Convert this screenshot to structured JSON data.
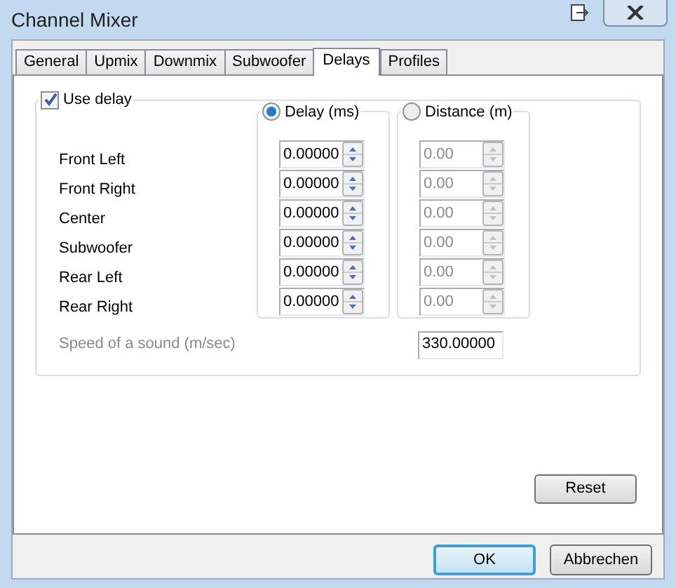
{
  "window": {
    "title": "Channel Mixer"
  },
  "tabs": [
    {
      "label": "General",
      "selected": false
    },
    {
      "label": "Upmix",
      "selected": false
    },
    {
      "label": "Downmix",
      "selected": false
    },
    {
      "label": "Subwoofer",
      "selected": false
    },
    {
      "label": "Delays",
      "selected": true
    },
    {
      "label": "Profiles",
      "selected": false
    }
  ],
  "use_delay": {
    "label": "Use delay",
    "checked": true
  },
  "mode_options": [
    {
      "label": "Delay (ms)",
      "selected": true
    },
    {
      "label": "Distance (m)",
      "selected": false
    }
  ],
  "channels": [
    {
      "name": "Front Left",
      "delay": "0.00000",
      "distance": "0.00"
    },
    {
      "name": "Front Right",
      "delay": "0.00000",
      "distance": "0.00"
    },
    {
      "name": "Center",
      "delay": "0.00000",
      "distance": "0.00"
    },
    {
      "name": "Subwoofer",
      "delay": "0.00000",
      "distance": "0.00"
    },
    {
      "name": "Rear Left",
      "delay": "0.00000",
      "distance": "0.00"
    },
    {
      "name": "Rear Right",
      "delay": "0.00000",
      "distance": "0.00"
    }
  ],
  "speed": {
    "label": "Speed of a sound (m/sec)",
    "value": "330.00000"
  },
  "reset_button": "Reset",
  "buttons": [
    {
      "label": "OK",
      "default": true
    },
    {
      "label": "Abbrechen",
      "default": false
    }
  ]
}
